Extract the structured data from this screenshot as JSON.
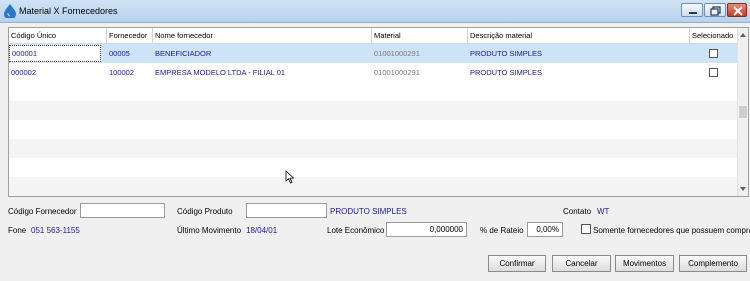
{
  "window": {
    "title": "Material X Fornecedores",
    "minimize_icon": "minimize-icon",
    "restore_icon": "restore-icon",
    "close_icon": "close-icon",
    "close_color": "#c23b26"
  },
  "grid": {
    "columns": [
      "Código Único",
      "Fornecedor",
      "Nome fornecedor",
      "Material",
      "Descrição material",
      "Selecionado"
    ],
    "rows": [
      {
        "codigo": "000001",
        "fornecedor": "00005",
        "nome": "BENEFICIADOR",
        "material": "01001000291",
        "descricao": "PRODUTO SIMPLES",
        "selecionado": false
      },
      {
        "codigo": "000002",
        "fornecedor": "100002",
        "nome": "EMPRESA MODELO LTDA - FILIAL 01",
        "material": "01001000291",
        "descricao": "PRODUTO SIMPLES",
        "selecionado": false
      }
    ],
    "selected_row_color": "#cce3f8",
    "text_color": "#1a1a9a"
  },
  "form": {
    "codigo_fornecedor_label": "Código Fornecedor",
    "codigo_fornecedor_value": "",
    "codigo_produto_label": "Código Produto",
    "codigo_produto_value": "",
    "produto_descricao": "PRODUTO SIMPLES",
    "contato_label": "Contato",
    "contato_value": "WT",
    "fone_label": "Fone",
    "fone_value": "051 563-1155",
    "ultimo_movimento_label": "Último Movimento",
    "ultimo_movimento_value": "18/04/01",
    "lote_label": "Lote Econômico",
    "lote_value": "0,000000",
    "rateio_label": "% de Rateio",
    "rateio_value": "0,00%",
    "somente_label": "Somente fornecedores que possuem compra",
    "somente_checked": false
  },
  "buttons": {
    "confirmar": "Confirmar",
    "cancelar": "Cancelar",
    "movimentos": "Movimentos",
    "complemento": "Complemento"
  }
}
